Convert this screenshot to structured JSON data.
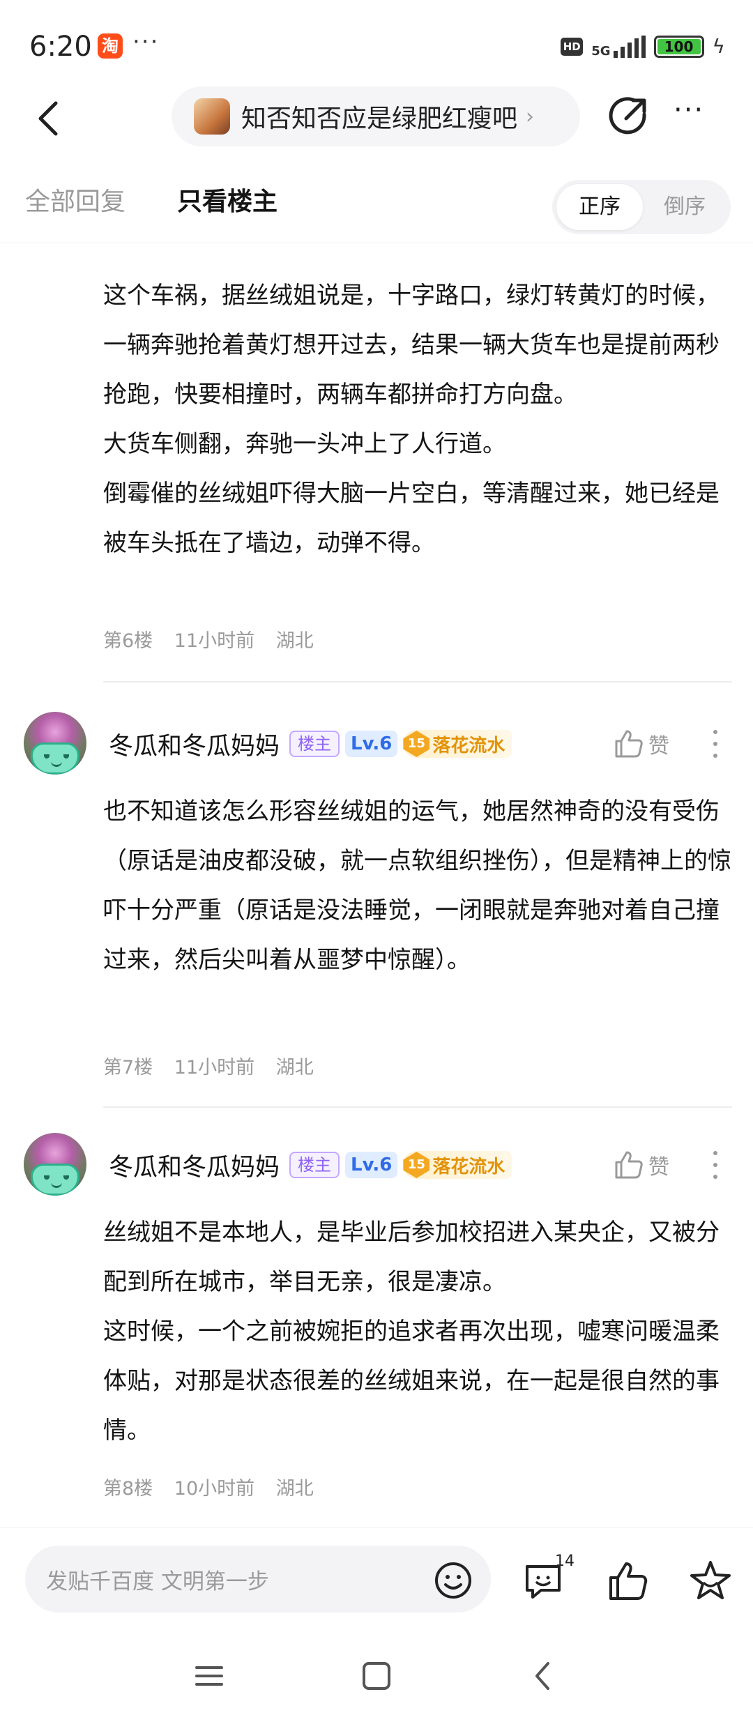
{
  "status_bar": {
    "time": "6:20",
    "app_icon_label": "淘",
    "more_dots": "···",
    "hd": "HD",
    "network": "5G",
    "battery": "100",
    "icons": [
      "taobao-icon",
      "hd-icon",
      "signal-icon",
      "battery-icon",
      "charging-icon"
    ]
  },
  "nav": {
    "forum_name": "知否知否应是绿肥红瘦吧",
    "forum_arrow": "›",
    "more": "···",
    "icons": [
      "back-icon",
      "share-icon",
      "more-icon"
    ]
  },
  "tabs": {
    "all_replies": "全部回复",
    "only_op": "只看楼主",
    "sort_asc": "正序",
    "sort_desc": "倒序"
  },
  "posts": [
    {
      "text": "这个车祸，据丝绒姐说是，十字路口，绿灯转黄灯的时候，一辆奔驰抢着黄灯想开过去，结果一辆大货车也是提前两秒抢跑，快要相撞时，两辆车都拼命打方向盘。\n大货车侧翻，奔驰一头冲上了人行道。\n倒霉催的丝绒姐吓得大脑一片空白，等清醒过来，她已经是被车头抵在了墙边，动弹不得。",
      "floor": "第6楼",
      "time": "11小时前",
      "location": "湖北"
    },
    {
      "username": "冬瓜和冬瓜妈妈",
      "badge_op": "楼主",
      "level": "Lv.6",
      "rank_number": "15",
      "rank_title": "落花流水",
      "like_label": "赞",
      "text": "也不知道该怎么形容丝绒姐的运气，她居然神奇的没有受伤（原话是油皮都没破，就一点软组织挫伤），但是精神上的惊吓十分严重（原话是没法睡觉，一闭眼就是奔驰对着自己撞过来，然后尖叫着从噩梦中惊醒）。",
      "floor": "第7楼",
      "time": "11小时前",
      "location": "湖北"
    },
    {
      "username": "冬瓜和冬瓜妈妈",
      "badge_op": "楼主",
      "level": "Lv.6",
      "rank_number": "15",
      "rank_title": "落花流水",
      "like_label": "赞",
      "text": "丝绒姐不是本地人，是毕业后参加校招进入某央企，又被分配到所在城市，举目无亲，很是凄凉。\n这时候，一个之前被婉拒的追求者再次出现，嘘寒问暖温柔体贴，对那是状态很差的丝绒姐来说，在一起是很自然的事情。",
      "floor": "第8楼",
      "time": "10小时前",
      "location": "湖北"
    }
  ],
  "bottom_bar": {
    "placeholder": "发贴千百度 文明第一步",
    "comment_count": "14",
    "icons": [
      "emoji-icon",
      "comment-icon",
      "like-icon",
      "favorite-icon"
    ]
  },
  "system_nav": {
    "icons": [
      "menu-icon",
      "home-icon",
      "back-icon"
    ]
  },
  "colors": {
    "primary_text": "#141414",
    "secondary_text": "#9a9a9a",
    "op_badge": "#8e63f2",
    "level_badge": "#2e6be6",
    "rank_badge": "#e2930a",
    "battery_green": "#41c441"
  }
}
